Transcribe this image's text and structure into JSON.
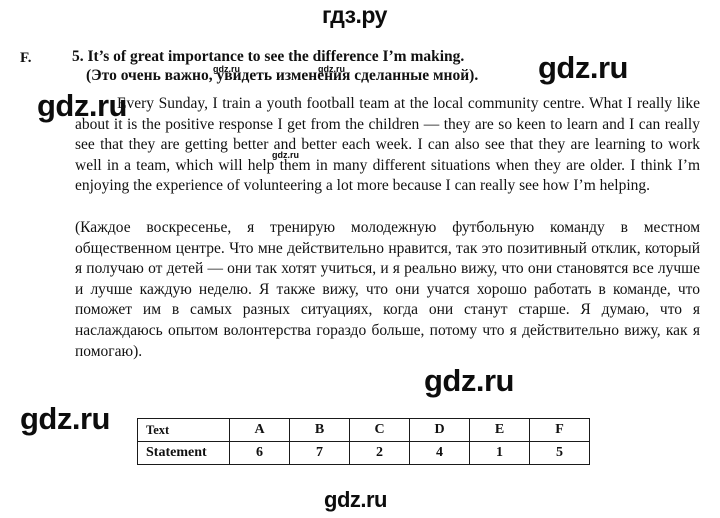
{
  "site": {
    "logo_top": "гдз.ру",
    "watermark": "gdz.ru",
    "watermarks": [
      {
        "id": "wm-head-left",
        "text": "gdz.ru"
      },
      {
        "id": "wm-head-right",
        "text": "gdz.ru"
      },
      {
        "id": "wm-big-right",
        "text": "gdz.ru"
      },
      {
        "id": "wm-big-left",
        "text": "gdz.ru"
      },
      {
        "id": "wm-mid-body",
        "text": "gdz.ru"
      },
      {
        "id": "wm-big-ru",
        "text": "gdz.ru"
      },
      {
        "id": "wm-big-table",
        "text": "gdz.ru"
      },
      {
        "id": "wm-bottom",
        "text": "gdz.ru"
      }
    ]
  },
  "exercise": {
    "letter": "F.",
    "heading_en": "5. It’s of great importance to see the difference I’m making.",
    "heading_ru": "(Это очень важно, увидеть изменения сделанные мной).",
    "paragraph_en": "Every Sunday, I train a youth football team at the local community centre. What I really like about it is the positive response I get from the children — they are so keen to learn and I can really see that they are getting better and better each week. I can also see that they are learning to work well in a team, which will help them in many different situations when they are older. I think I’m enjoying the experience of volunteering a lot more because I can really see how I’m helping.",
    "paragraph_ru": "(Каждое воскресенье, я тренирую молодежную футбольную команду в местном общественном центре. Что мне действительно нравится, так это позитивный отклик, который я получаю от детей — они так хотят учиться, и я реально вижу, что они становятся все лучше и лучше каждую неделю. Я также вижу, что они учатся хорошо работать в команде, что поможет им в самых разных ситуациях, когда они станут старше. Я думаю, что я наслаждаюсь опытом волонтерства гораздо больше, потому что я действительно вижу, как я помогаю)."
  },
  "answer_table": {
    "rows": [
      {
        "label": "Text",
        "cells": [
          "A",
          "B",
          "C",
          "D",
          "E",
          "F"
        ]
      },
      {
        "label": "Statement",
        "cells": [
          "6",
          "7",
          "2",
          "4",
          "1",
          "5"
        ]
      }
    ]
  }
}
